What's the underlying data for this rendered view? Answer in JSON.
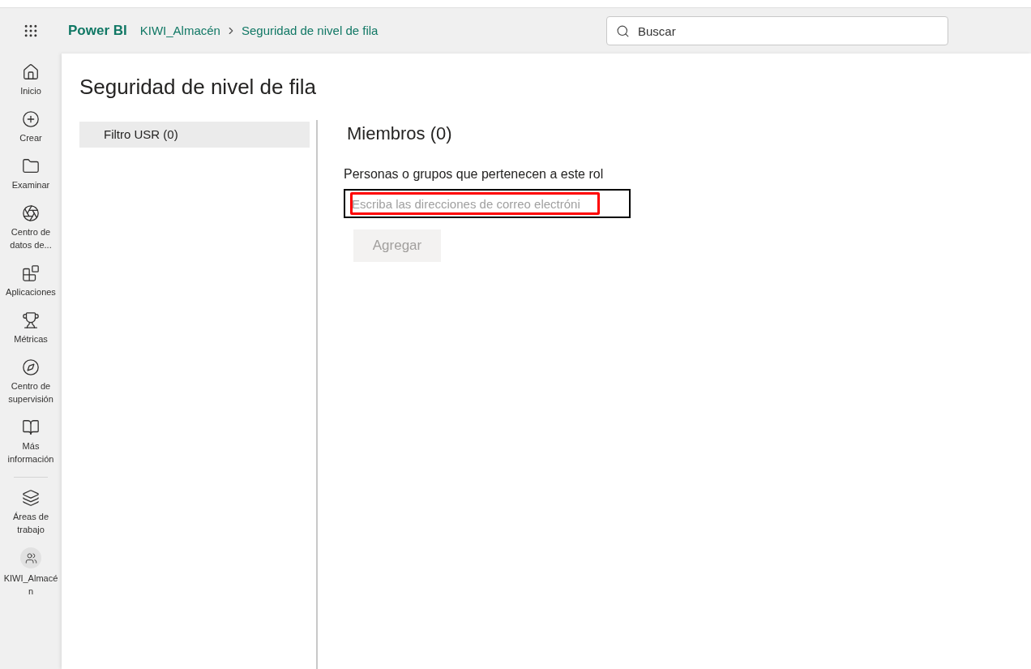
{
  "header": {
    "app_name": "Power BI",
    "breadcrumb": [
      {
        "label": "KIWI_Almacén"
      },
      {
        "label": "Seguridad de nivel de fila"
      }
    ],
    "search": {
      "placeholder": "Buscar"
    }
  },
  "nav": [
    {
      "kind": "home",
      "label": "Inicio"
    },
    {
      "kind": "create",
      "label": "Crear"
    },
    {
      "kind": "browse",
      "label": "Examinar"
    },
    {
      "kind": "datahub",
      "label": "Centro de datos de..."
    },
    {
      "kind": "apps",
      "label": "Aplicaciones"
    },
    {
      "kind": "metrics",
      "label": "Métricas"
    },
    {
      "kind": "monitor",
      "label": "Centro de supervisión"
    },
    {
      "kind": "learn",
      "label": "Más información"
    },
    {
      "kind": "divider"
    },
    {
      "kind": "workspaces",
      "label": "Áreas de trabajo"
    },
    {
      "kind": "workspace",
      "label": "KIWI_Almacén"
    }
  ],
  "page_title": "Seguridad de nivel de fila",
  "roles": [
    {
      "label": "Filtro USR (0)",
      "selected": true
    }
  ],
  "members": {
    "title": "Miembros (0)",
    "field_label": "Personas o grupos que pertenecen a este rol",
    "field_placeholder": "Escriba las direcciones de correo electróni",
    "add_button": {
      "label": "Agregar",
      "disabled": true
    }
  }
}
